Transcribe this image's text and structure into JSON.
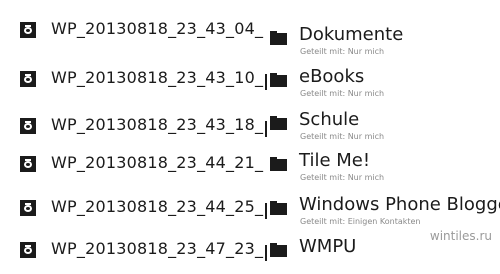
{
  "files": [
    {
      "name": "WP_20130818_23_43_04_"
    },
    {
      "name": "WP_20130818_23_43_10_"
    },
    {
      "name": "WP_20130818_23_43_18_"
    },
    {
      "name": "WP_20130818_23_44_21_"
    },
    {
      "name": "WP_20130818_23_44_25_"
    },
    {
      "name": "WP_20130818_23_47_23_"
    }
  ],
  "folders": [
    {
      "name": "Dokumente",
      "shared": "Geteilt mit: Nur mich"
    },
    {
      "name": "eBooks",
      "shared": "Geteilt mit: Nur mich"
    },
    {
      "name": "Schule",
      "shared": "Geteilt mit: Nur mich"
    },
    {
      "name": "Tile Me!",
      "shared": "Geteilt mit: Nur mich"
    },
    {
      "name": "Windows Phone Blogger",
      "shared": "Geteilt mit: Einigen Kontakten"
    },
    {
      "name": "WMPU",
      "shared": ""
    }
  ],
  "icons": {
    "file": "camera-photo-icon",
    "folder": "folder-icon"
  },
  "watermark": "wintiles.ru"
}
